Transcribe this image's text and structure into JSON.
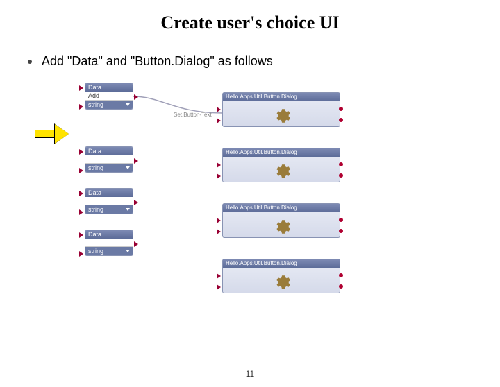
{
  "title": "Create user's choice UI",
  "bullet": "Add \"Data\" and \"Button.Dialog\" as follows",
  "set_label": "Set.Button-Text",
  "page_number": "11",
  "data_blocks": [
    {
      "header": "Data",
      "value": "Add",
      "type": "string"
    },
    {
      "header": "Data",
      "value": "",
      "type": "string"
    },
    {
      "header": "Data",
      "value": "",
      "type": "string"
    },
    {
      "header": "Data",
      "value": "",
      "type": "string"
    }
  ],
  "dialog_blocks": [
    {
      "header": "Hello.Apps.Util.Button.Dialog"
    },
    {
      "header": "Hello.Apps.Util.Button.Dialog"
    },
    {
      "header": "Hello.Apps.Util.Button.Dialog"
    },
    {
      "header": "Hello.Apps.Util.Button.Dialog"
    }
  ]
}
